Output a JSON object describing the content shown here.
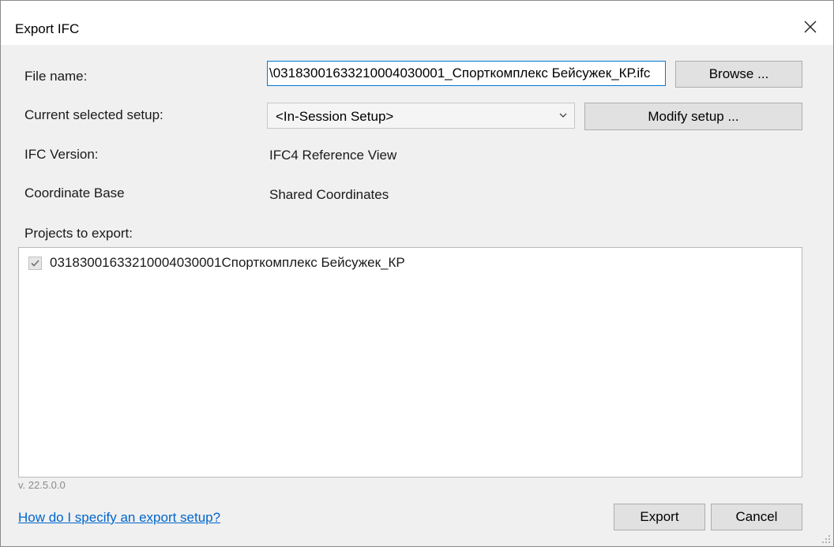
{
  "window": {
    "title": "Export IFC"
  },
  "form": {
    "file_name_label": "File name:",
    "file_name_value": "\\03183001633210004030001_Спорткомплекс Бейсужек_КР.ifc",
    "browse_label": "Browse ...",
    "setup_label": "Current selected setup:",
    "setup_value": "<In-Session Setup>",
    "modify_label": "Modify setup ...",
    "ifc_version_label": "IFC Version:",
    "ifc_version_value": "IFC4 Reference View",
    "coord_label": "Coordinate Base",
    "coord_value": "Shared Coordinates",
    "projects_label": "Projects to export:"
  },
  "projects": [
    {
      "label": "03183001633210004030001Спорткомплекс Бейсужек_КР",
      "checked": true
    }
  ],
  "footer": {
    "version": "v. 22.5.0.0",
    "help_link": "How do I specify an export setup?",
    "export_label": "Export",
    "cancel_label": "Cancel"
  },
  "colors": {
    "accent": "#0078d7",
    "link": "#0066cc",
    "dialog_bg": "#f0f0f0",
    "button_bg": "#e1e1e1"
  }
}
